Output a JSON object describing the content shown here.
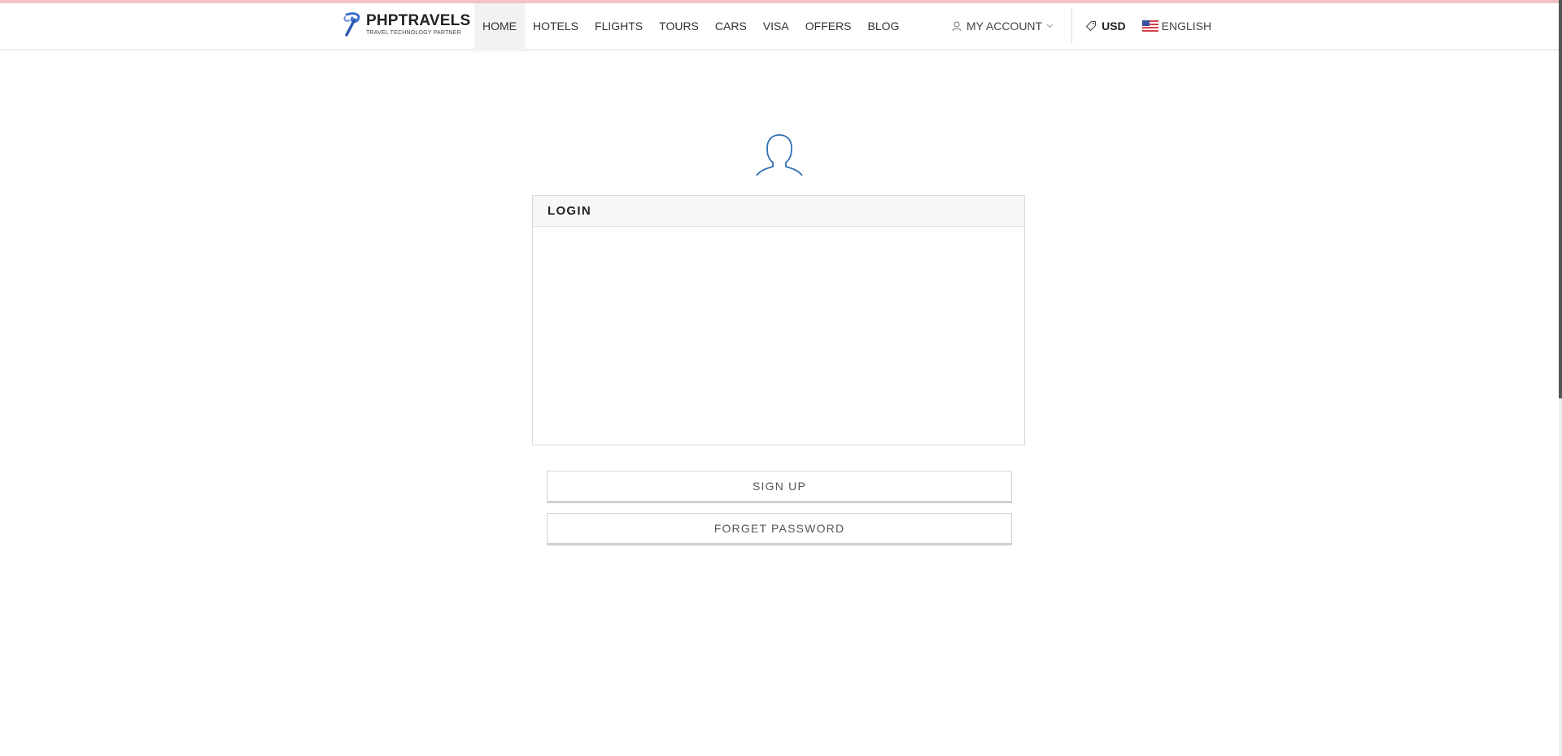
{
  "brand": {
    "name": "PHPTRAVELS",
    "tagline": "TRAVEL TECHNOLOGY PARTNER",
    "accent_color": "#f4c2c8",
    "icon_color": "#3b6fd1"
  },
  "nav": {
    "items": [
      {
        "label": "HOME",
        "active": true
      },
      {
        "label": "HOTELS"
      },
      {
        "label": "FLIGHTS"
      },
      {
        "label": "TOURS"
      },
      {
        "label": "CARS"
      },
      {
        "label": "VISA"
      },
      {
        "label": "OFFERS"
      },
      {
        "label": "BLOG"
      }
    ],
    "account_label": "MY ACCOUNT",
    "currency": "USD",
    "language": "ENGLISH"
  },
  "login": {
    "title": "LOGIN",
    "avatar_icon": "user-outline-icon",
    "avatar_color": "#2f6fb3"
  },
  "buttons": {
    "signup": "SIGN UP",
    "forget_password": "FORGET PASSWORD"
  }
}
